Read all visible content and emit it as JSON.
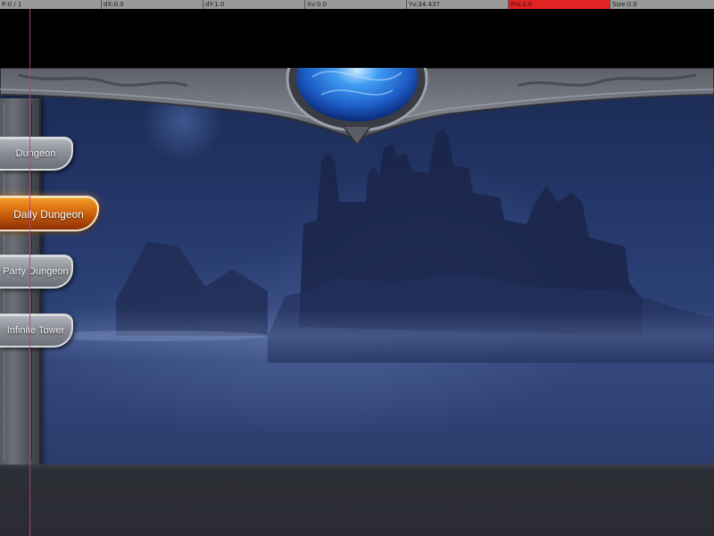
{
  "debug": {
    "pointer": "P:0 / 1",
    "dx": "dX:0.0",
    "dy": "dY:1.0",
    "xv": "Xv:0.0",
    "yv": "Yv:34.437",
    "prs": "Prs:1.0",
    "size": "Size:0.0"
  },
  "menu": {
    "items": [
      {
        "label": "Dungeon",
        "active": false
      },
      {
        "label": "Daily Dungeon",
        "active": true
      },
      {
        "label": "Party Dungeon",
        "active": false
      },
      {
        "label": "Infinite Tower",
        "active": false
      }
    ]
  },
  "colors": {
    "active_tab": "#d96d10",
    "inactive_tab": "#8c8f97",
    "pressure_alert": "#e02424",
    "touch_cursor": "#c0389a",
    "orb": "#1e7be0"
  }
}
